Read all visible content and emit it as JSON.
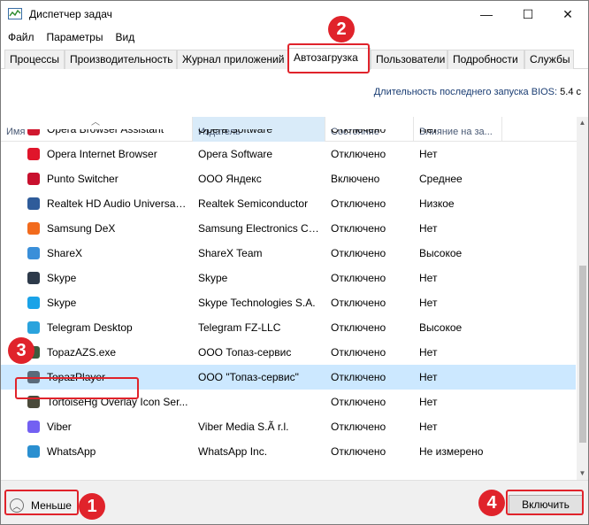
{
  "window": {
    "title": "Диспетчер задач",
    "minimize_glyph": "—",
    "maximize_glyph": "☐",
    "close_glyph": "✕"
  },
  "menu": [
    "Файл",
    "Параметры",
    "Вид"
  ],
  "tabs": [
    {
      "label": "Процессы",
      "active": false
    },
    {
      "label": "Производительность",
      "active": false
    },
    {
      "label": "Журнал приложений",
      "active": false
    },
    {
      "label": "Автозагрузка",
      "active": true
    },
    {
      "label": "Пользователи",
      "active": false
    },
    {
      "label": "Подробности",
      "active": false
    },
    {
      "label": "Службы",
      "active": false
    }
  ],
  "bios": {
    "label": "Длительность последнего запуска BIOS:",
    "value": "5.4 с"
  },
  "columns": {
    "name": "Имя",
    "publisher": "Издатель",
    "state": "Состояние",
    "impact": "Влияние на за..."
  },
  "rows": [
    {
      "name": "Opera Browser Assistant",
      "publisher": "Opera Software",
      "state": "Отключено",
      "impact": "Нет",
      "icon": "opera-assistant-icon",
      "color": "#d0182f",
      "selected": false
    },
    {
      "name": "Opera Internet Browser",
      "publisher": "Opera Software",
      "state": "Отключено",
      "impact": "Нет",
      "icon": "opera-icon",
      "color": "#e0152b",
      "selected": false
    },
    {
      "name": "Punto Switcher",
      "publisher": "ООО Яндекс",
      "state": "Включено",
      "impact": "Среднее",
      "icon": "punto-switcher-icon",
      "color": "#c8102e",
      "selected": false
    },
    {
      "name": "Realtek HD Audio Universal ...",
      "publisher": "Realtek Semiconductor",
      "state": "Отключено",
      "impact": "Низкое",
      "icon": "realtek-icon",
      "color": "#2f5c9a",
      "selected": false
    },
    {
      "name": "Samsung DeX",
      "publisher": "Samsung Electronics Co....",
      "state": "Отключено",
      "impact": "Нет",
      "icon": "samsung-dex-icon",
      "color": "#f26b1d",
      "selected": false
    },
    {
      "name": "ShareX",
      "publisher": "ShareX Team",
      "state": "Отключено",
      "impact": "Высокое",
      "icon": "sharex-icon",
      "color": "#3a8fd9",
      "selected": false
    },
    {
      "name": "Skype",
      "publisher": "Skype",
      "state": "Отключено",
      "impact": "Нет",
      "icon": "skype-icon",
      "color": "#2d3a4a",
      "selected": false
    },
    {
      "name": "Skype",
      "publisher": "Skype Technologies S.A.",
      "state": "Отключено",
      "impact": "Нет",
      "icon": "skype-icon",
      "color": "#1aa3e8",
      "selected": false
    },
    {
      "name": "Telegram Desktop",
      "publisher": "Telegram FZ-LLC",
      "state": "Отключено",
      "impact": "Высокое",
      "icon": "telegram-icon",
      "color": "#2aa3dd",
      "selected": false
    },
    {
      "name": "TopazAZS.exe",
      "publisher": "ООО Топаз-сервис",
      "state": "Отключено",
      "impact": "Нет",
      "icon": "topaz-azs-icon",
      "color": "#3d5a3d",
      "selected": false
    },
    {
      "name": "TopazPlayer",
      "publisher": "ООО \"Топаз-сервис\"",
      "state": "Отключено",
      "impact": "Нет",
      "icon": "topaz-player-icon",
      "color": "#5a6a7a",
      "selected": true
    },
    {
      "name": "TortoiseHg Overlay Icon Ser...",
      "publisher": "",
      "state": "Отключено",
      "impact": "Нет",
      "icon": "tortoisehg-icon",
      "color": "#4a4a3a",
      "selected": false
    },
    {
      "name": "Viber",
      "publisher": "Viber Media S.Ã  r.l.",
      "state": "Отключено",
      "impact": "Нет",
      "icon": "viber-icon",
      "color": "#7360f2",
      "selected": false
    },
    {
      "name": "WhatsApp",
      "publisher": "WhatsApp Inc.",
      "state": "Отключено",
      "impact": "Не измерено",
      "icon": "whatsapp-icon",
      "color": "#2a8fd0",
      "selected": false
    }
  ],
  "footer": {
    "fewer_label": "Меньше",
    "enable_label": "Включить"
  },
  "annotations": [
    "1",
    "2",
    "3",
    "4"
  ],
  "accent_red": "#e0232b",
  "selection_color": "#cce8ff"
}
